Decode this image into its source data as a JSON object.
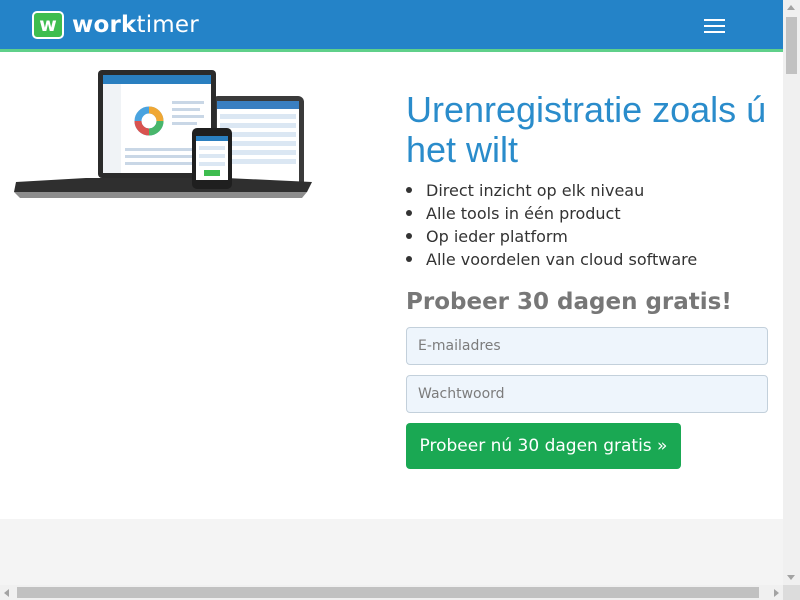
{
  "header": {
    "logo_letter": "w",
    "brand_bold": "work",
    "brand_rest": "timer",
    "menu_icon": "hamburger-menu-icon",
    "bar_color": "#2483c8",
    "accent_color": "#5fd08a"
  },
  "hero": {
    "image_icon": "devices-illustration",
    "headline": "Urenregistratie zoals ú het wilt",
    "features": [
      "Direct inzicht op elk niveau",
      "Alle tools in één product",
      "Op ieder platform",
      "Alle voordelen van cloud software"
    ],
    "trial_title": "Probeer 30 dagen gratis!",
    "email_placeholder": "E-mailadres",
    "password_placeholder": "Wachtwoord",
    "cta_label": "Probeer nú 30 dagen gratis »",
    "cta_color": "#1aa853"
  }
}
